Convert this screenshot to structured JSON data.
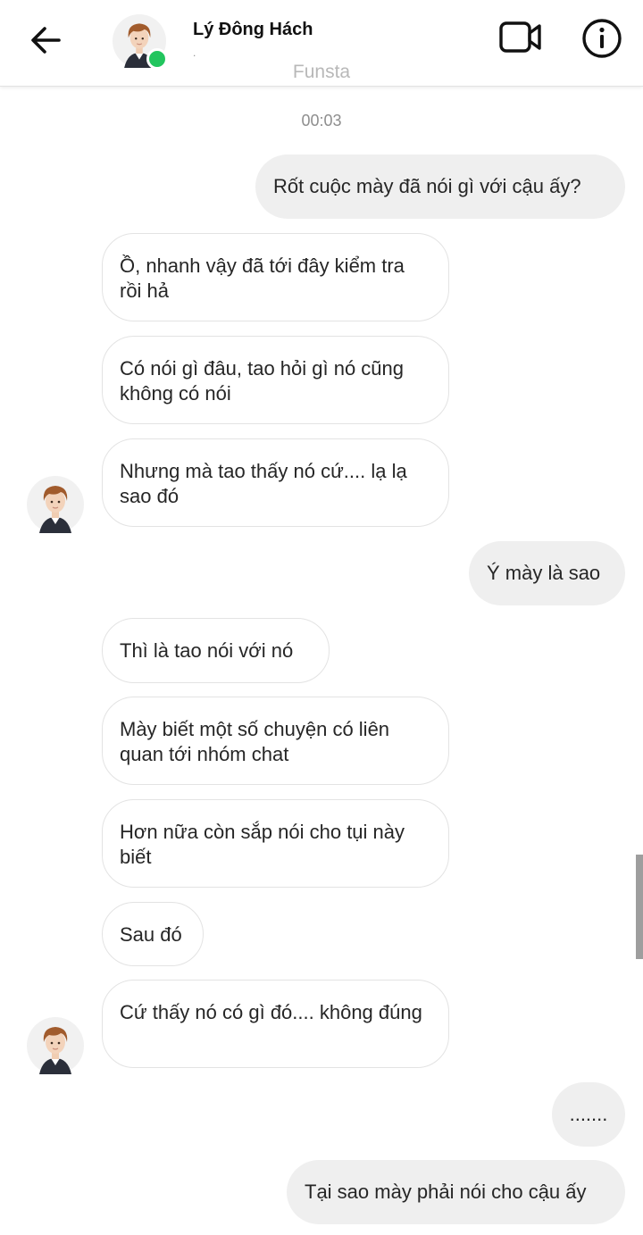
{
  "header": {
    "back_icon": "arrow-left-icon",
    "contact_name": "Lý Đông Hách",
    "contact_subtitle": ".",
    "brand": "Funsta",
    "video_icon": "video-camera-icon",
    "info_icon": "info-icon",
    "online_color": "#22c55e"
  },
  "conversation": {
    "timestamp": "00:03",
    "messages": [
      {
        "direction": "out",
        "text": "Rốt cuộc mày đã nói gì với cậu ấy?"
      },
      {
        "direction": "in",
        "text": "Ồ, nhanh vậy đã tới đây kiểm tra rồi hả"
      },
      {
        "direction": "in",
        "text": "Có nói gì đâu, tao hỏi gì nó cũng không có nói"
      },
      {
        "direction": "in",
        "text": "Nhưng mà tao thấy nó cứ.... lạ lạ sao đó",
        "avatar": true
      },
      {
        "direction": "out",
        "text": "Ý mày là sao"
      },
      {
        "direction": "in",
        "text": "Thì là tao nói với nó"
      },
      {
        "direction": "in",
        "text": "Mày biết một số chuyện có liên quan tới nhóm chat"
      },
      {
        "direction": "in",
        "text": "Hơn nữa còn sắp nói cho tụi này biết"
      },
      {
        "direction": "in",
        "text": "Sau đó"
      },
      {
        "direction": "in",
        "text": "Cứ thấy nó có gì đó.... không đúng",
        "avatar": true
      },
      {
        "direction": "out",
        "text": "......."
      },
      {
        "direction": "out",
        "text": "Tại sao mày phải nói cho cậu ấy"
      }
    ]
  },
  "colors": {
    "incoming_bg": "#ffffff",
    "incoming_border": "#e3e3e3",
    "outgoing_bg": "#efefef"
  }
}
